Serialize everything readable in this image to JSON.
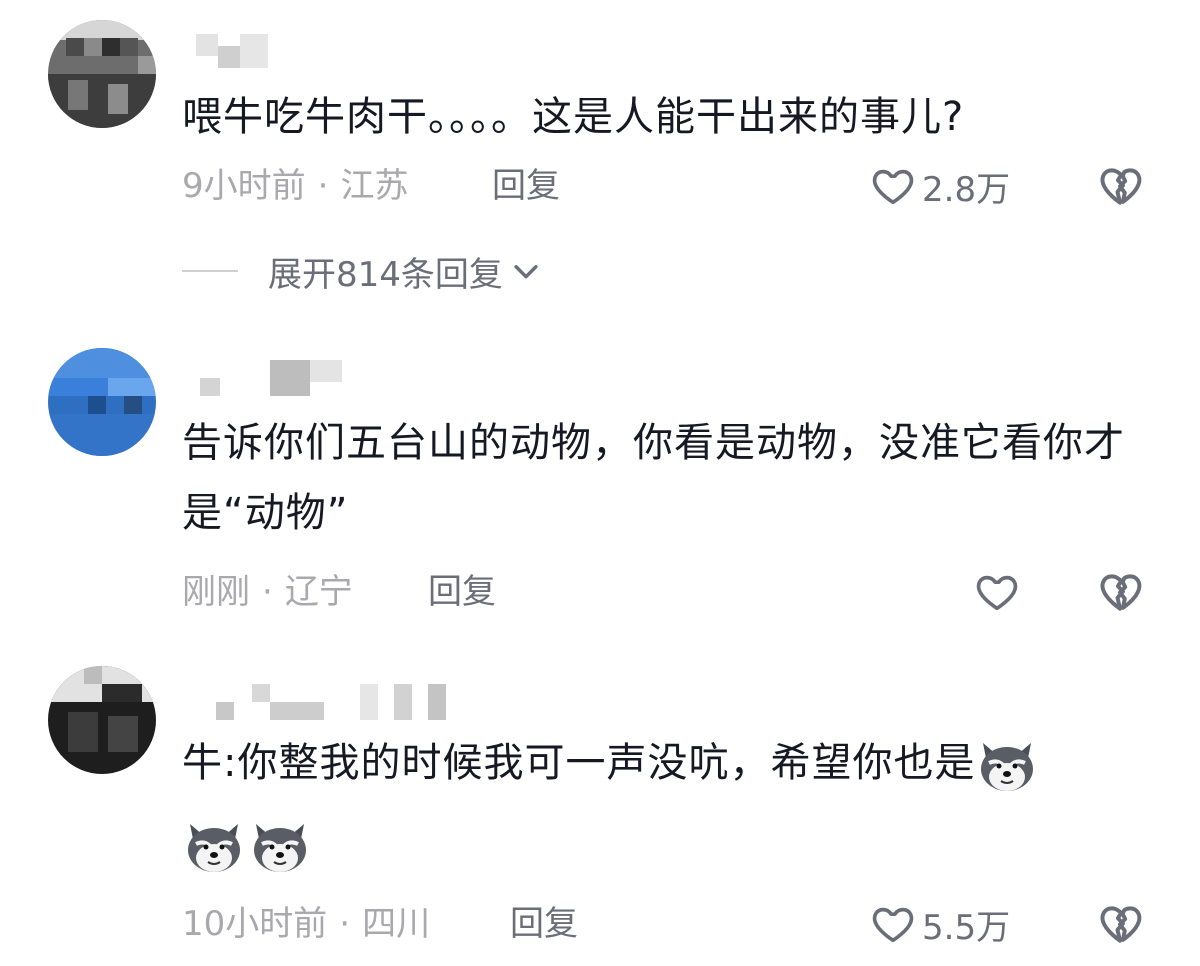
{
  "comments": [
    {
      "text": "喂牛吃牛肉干。。。。这是人能干出来的事儿?",
      "time": "9小时前",
      "location": "江苏",
      "reply_label": "回复",
      "like_count": "2.8万",
      "expand_label": "展开814条回复"
    },
    {
      "text": "告诉你们五台山的动物，你看是动物，没准它看你才是“动物”",
      "time": "刚刚",
      "location": "辽宁",
      "reply_label": "回复",
      "like_count": ""
    },
    {
      "text": "牛:你整我的时候我可一声没吭，希望你也是",
      "emoji": "wolf-face-emoji",
      "time": "10小时前",
      "location": "四川",
      "reply_label": "回复",
      "like_count": "5.5万"
    }
  ],
  "meta_separator": "·",
  "icons": {
    "like": "heart-outline-icon",
    "dislike": "broken-heart-icon",
    "expand": "chevron-down-icon"
  },
  "colors": {
    "text": "#161823",
    "meta": "#a8a8ad",
    "action": "#6b6e78"
  }
}
